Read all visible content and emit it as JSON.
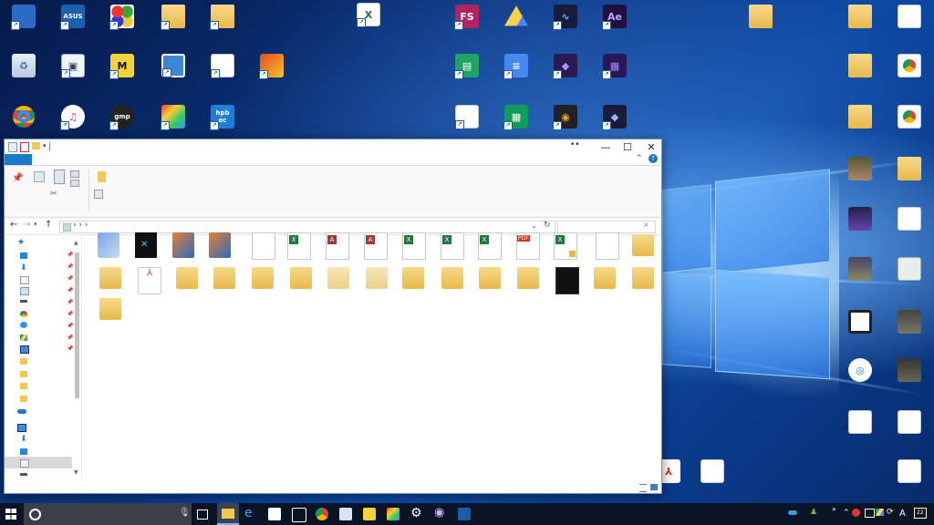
{
  "desktop": {
    "icon_labels": {
      "asus": "ASUS",
      "freestudio": "FS",
      "aftereffects": "Ae",
      "gom": "gmp",
      "hpbec": "hpb ec",
      "mpc": "M"
    }
  },
  "explorer": {
    "pdf_label": "PDF",
    "addr_chevrons": "›  ›  ›"
  },
  "taskbar": {
    "lang": "A",
    "notif_count": "22"
  },
  "colors": {
    "accent": "#1979ca",
    "taskbar": "#0b1424"
  }
}
